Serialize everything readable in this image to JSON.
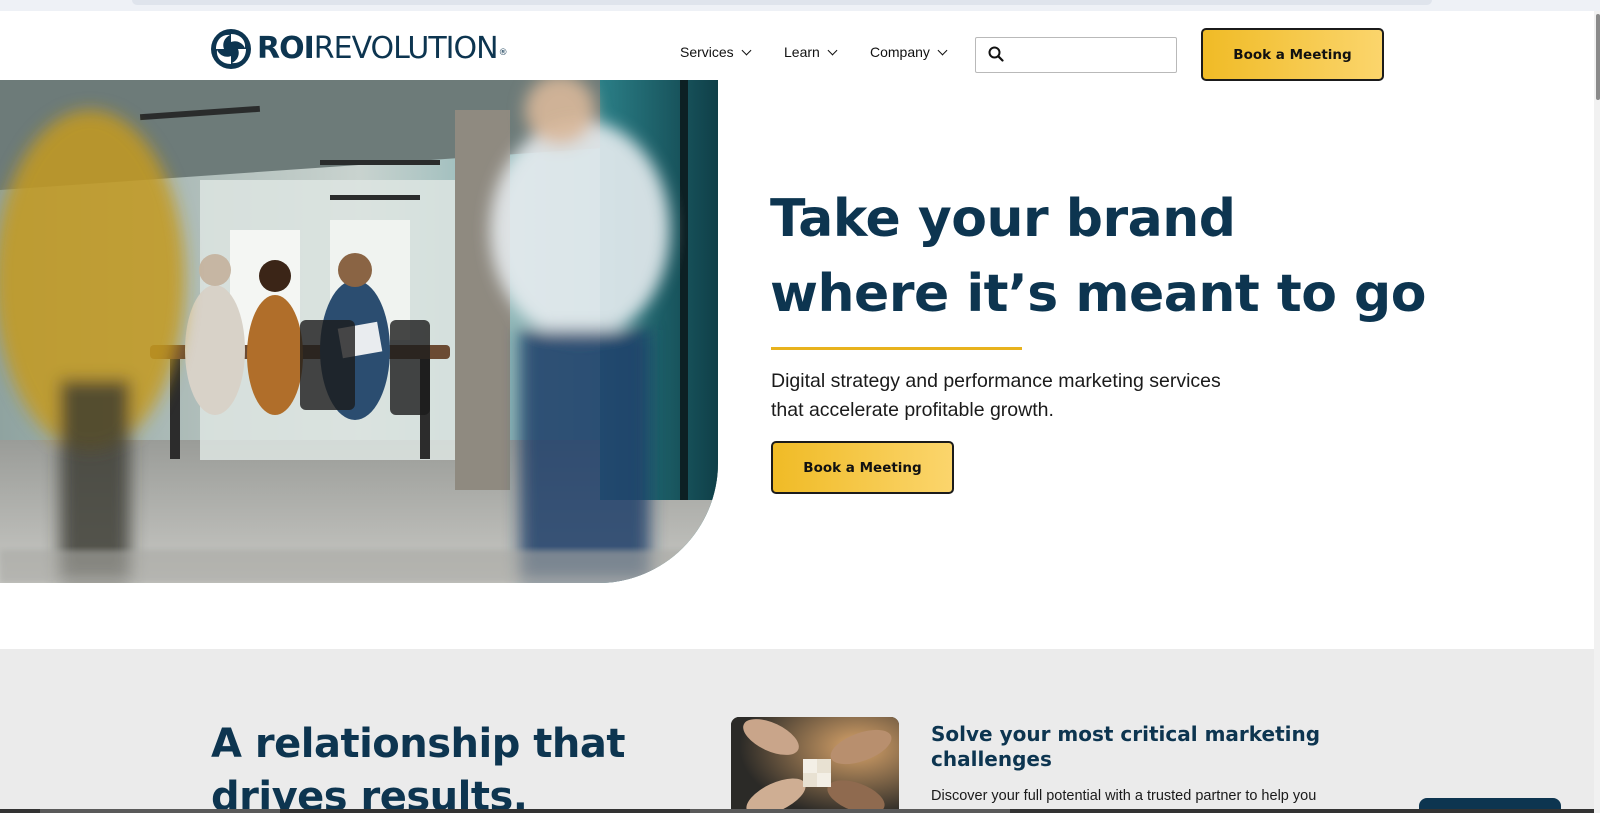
{
  "brand": {
    "logo_bold": "ROI",
    "logo_light": "REVOLUTION",
    "logo_reg": "®",
    "colors": {
      "navy": "#0d3550",
      "gold": "#f0bb26",
      "gold_light": "#fbd56c",
      "rule": "#e8b21d",
      "section_bg": "#ebebeb"
    }
  },
  "nav": {
    "items": [
      {
        "label": "Services",
        "icon": "chevron-down-icon"
      },
      {
        "label": "Learn",
        "icon": "chevron-down-icon"
      },
      {
        "label": "Company",
        "icon": "chevron-down-icon"
      }
    ],
    "search": {
      "placeholder": "",
      "value": "",
      "icon": "search-icon"
    },
    "cta_label": "Book a Meeting"
  },
  "hero": {
    "title_line1": "Take your brand",
    "title_line2": "where it’s meant to go",
    "subtitle_line1": "Digital strategy and performance marketing services",
    "subtitle_line2": "that accelerate profitable growth.",
    "cta_label": "Book a Meeting"
  },
  "relationship": {
    "title_line1": "A relationship that",
    "title_line2": "drives results.",
    "card": {
      "title_line1": "Solve your most critical marketing",
      "title_line2": "challenges",
      "text": "Discover your full potential with a trusted partner to help you"
    }
  }
}
